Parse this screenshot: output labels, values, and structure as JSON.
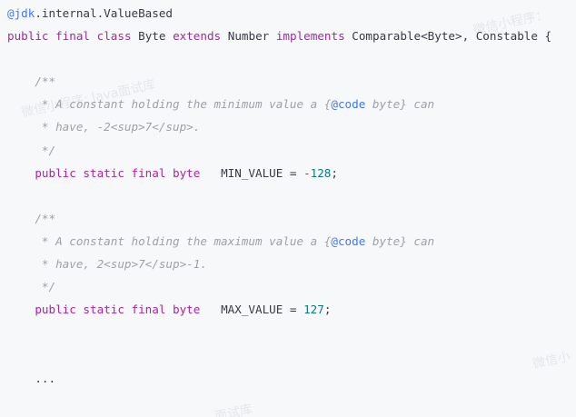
{
  "code": {
    "annotation": "@jdk",
    "annotation_rest": ".internal.ValueBased",
    "class_decl": {
      "kw_public": "public",
      "kw_final": "final",
      "kw_class": "class",
      "name": "Byte",
      "kw_extends": "extends",
      "super": "Number",
      "kw_implements": "implements",
      "interfaces": "Comparable<Byte>, Constable {"
    },
    "comment_min": {
      "open": "/**",
      "line1_a": " * A constant holding the minimum value a {",
      "line1_tag": "@code",
      "line1_b": " byte} can",
      "line2": " * have, -2<sup>7</sup>.",
      "close": " */"
    },
    "field_min": {
      "mods": "public static final byte",
      "decl": "   MIN_VALUE = ",
      "value": "-128",
      "end": ";"
    },
    "comment_max": {
      "open": "/**",
      "line1_a": " * A constant holding the maximum value a {",
      "line1_tag": "@code",
      "line1_b": " byte} can",
      "line2": " * have, 2<sup>7</sup>-1.",
      "close": " */"
    },
    "field_max": {
      "mods": "public static final byte",
      "decl": "   MAX_VALUE = ",
      "value": "127",
      "end": ";"
    },
    "ellipsis": "...",
    "closing_brace": "}"
  },
  "watermarks": {
    "wm1": "微信小程序: Java面试库",
    "wm2": "微信小程序：",
    "wm3": "微信小",
    "wm4": "面试库"
  },
  "colors": {
    "background": "#f6f8fa",
    "keyword": "#a626a4",
    "comment": "#a0a1a7",
    "annotation": "#4078f2",
    "number": "#0b7a7a",
    "text": "#383a42"
  }
}
